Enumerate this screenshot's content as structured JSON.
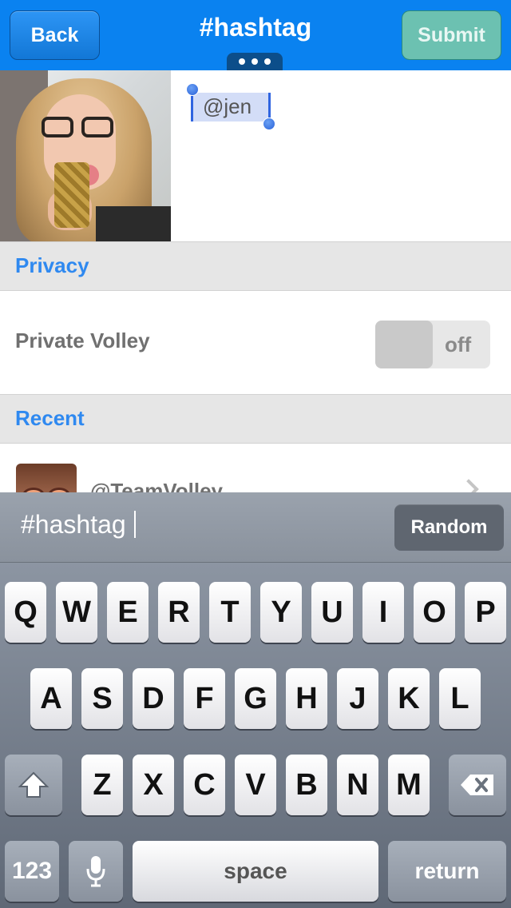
{
  "navbar": {
    "back_label": "Back",
    "title": "#hashtag",
    "submit_label": "Submit"
  },
  "compose": {
    "mention_text": "@jen"
  },
  "privacy": {
    "header": "Privacy",
    "row_label": "Private Volley",
    "toggle_state": "off"
  },
  "recent": {
    "header": "Recent",
    "items": [
      {
        "name": "@TeamVolley"
      }
    ]
  },
  "accessory": {
    "input_value": "#hashtag",
    "random_label": "Random"
  },
  "keyboard": {
    "row1": [
      "Q",
      "W",
      "E",
      "R",
      "T",
      "Y",
      "U",
      "I",
      "O",
      "P"
    ],
    "row2": [
      "A",
      "S",
      "D",
      "F",
      "G",
      "H",
      "J",
      "K",
      "L"
    ],
    "row3": [
      "Z",
      "X",
      "C",
      "V",
      "B",
      "N",
      "M"
    ],
    "numbers_label": "123",
    "space_label": "space",
    "return_label": "return"
  },
  "colors": {
    "navbar": "#0a82f0",
    "section_header_text": "#2f89f0",
    "submit_button": "#6cc1b1"
  }
}
